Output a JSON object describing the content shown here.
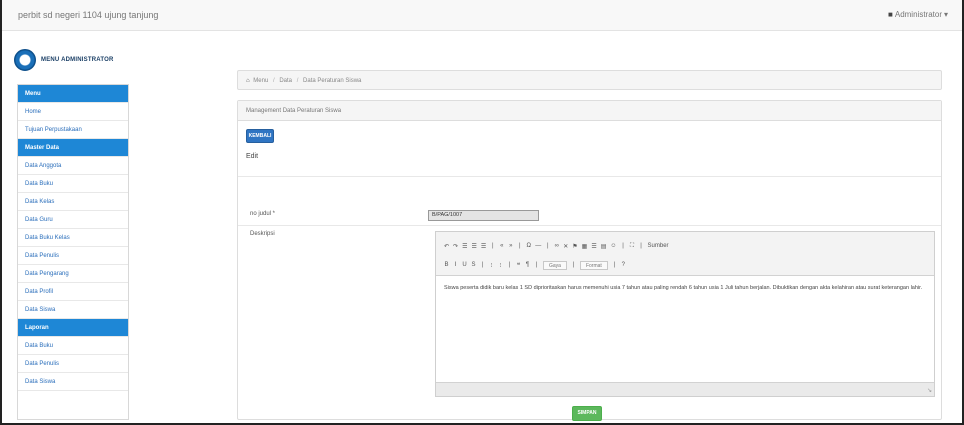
{
  "topbar": {
    "brand": "perbit sd negeri 1104 ujung tanjung",
    "user": "Administrator",
    "user_caret": "▾"
  },
  "logo": {
    "text": "MENU ADMINISTRATOR"
  },
  "sidebar": {
    "items": [
      {
        "label": "Menu",
        "type": "header"
      },
      {
        "label": "Home",
        "type": "link"
      },
      {
        "label": "Tujuan Perpustakaan",
        "type": "link"
      },
      {
        "label": "Master Data",
        "type": "header"
      },
      {
        "label": "Data Anggota",
        "type": "link"
      },
      {
        "label": "Data Buku",
        "type": "link"
      },
      {
        "label": "Data Kelas",
        "type": "link"
      },
      {
        "label": "Data Guru",
        "type": "link"
      },
      {
        "label": "Data Buku Kelas",
        "type": "link"
      },
      {
        "label": "Data Penulis",
        "type": "link"
      },
      {
        "label": "Data Pengarang",
        "type": "link"
      },
      {
        "label": "Data Profil",
        "type": "link"
      },
      {
        "label": "Data Siswa",
        "type": "link"
      },
      {
        "label": "Laporan",
        "type": "header"
      },
      {
        "label": "Data Buku",
        "type": "link"
      },
      {
        "label": "Data Penulis",
        "type": "link"
      },
      {
        "label": "Data Siswa",
        "type": "link"
      }
    ]
  },
  "breadcrumb": {
    "home": "Menu",
    "level2": "Data",
    "level3": "Data Peraturan Siswa"
  },
  "panel": {
    "title": "Management Data Peraturan Siswa",
    "back_button": "KEMBALI",
    "section_label": "Edit",
    "fields": {
      "nojudul_label": "no judul *",
      "nojudul_value": "B/PAG/1007",
      "deskripsi_label": "Deskripsi"
    },
    "editor": {
      "toolbar_row1": [
        "↶",
        "↷",
        "☰",
        "☰",
        "☰",
        "|",
        "«",
        "»",
        "|",
        "Ω",
        "—",
        "|",
        "∞",
        "✕",
        "⚑",
        "▦",
        "☰",
        "▤",
        "☺",
        "|",
        "⛶",
        "|",
        "Sumber"
      ],
      "toolbar_row2": [
        "B",
        "I",
        "U",
        "S",
        "|",
        "⁝",
        "⁝",
        "|",
        "❝",
        "¶",
        "|",
        "Gaya",
        "|",
        "Format",
        "|",
        "?"
      ],
      "style_select": "Gaya",
      "format_select": "Format",
      "content": "Siswa peserta didik baru kelas 1 SD diprioritaskan harus memenuhi usia 7 tahun atau paling rendah 6 tahun usia 1 Juli tahun berjalan. Dibuktikan dengan akta kelahiran atau surat keterangan lahir."
    },
    "save_button": "SIMPAN"
  }
}
